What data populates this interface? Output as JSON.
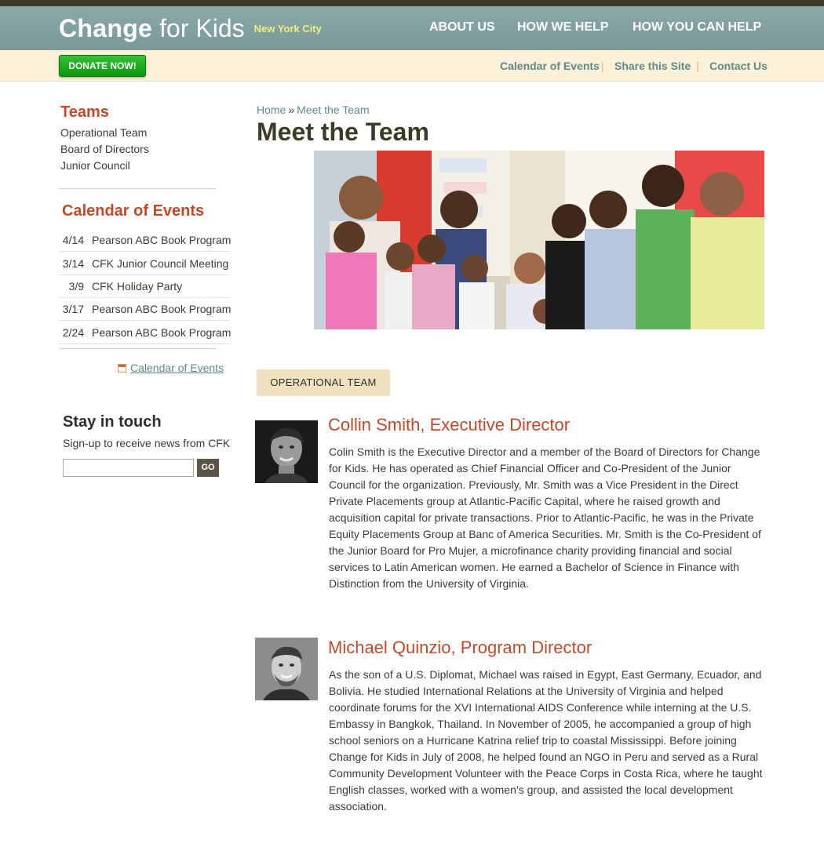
{
  "brand": {
    "name_strong": "Change",
    "name_light": "for Kids",
    "city": "New York City"
  },
  "nav": {
    "items": [
      {
        "label": "ABOUT US"
      },
      {
        "label": "HOW WE HELP"
      },
      {
        "label": "HOW YOU CAN HELP"
      }
    ]
  },
  "subbar": {
    "donate_label": "DONATE NOW!",
    "links": [
      {
        "label": "Calendar of Events"
      },
      {
        "label": "Share this Site"
      },
      {
        "label": "Contact Us"
      }
    ],
    "separator": "|"
  },
  "sidebar": {
    "teams_heading": "Teams",
    "teams": [
      {
        "label": "Operational Team"
      },
      {
        "label": "Board of Directors"
      },
      {
        "label": "Junior Council"
      }
    ],
    "calendar_heading": "Calendar of Events",
    "events": [
      {
        "date": "4/14",
        "name": "Pearson ABC Book Program"
      },
      {
        "date": "3/14",
        "name": "CFK Junior Council Meeting"
      },
      {
        "date": "3/9",
        "name": "CFK Holiday Party"
      },
      {
        "date": "3/17",
        "name": "Pearson ABC Book Program"
      },
      {
        "date": "2/24",
        "name": "Pearson ABC Book Program"
      }
    ],
    "calendar_link": "Calendar of Events",
    "calendar_icon": "calendar-icon",
    "stay_heading": "Stay in touch",
    "stay_sub": "Sign-up to receive news from CFK",
    "newsletter_value": "",
    "go_label": "GO"
  },
  "main": {
    "breadcrumb": {
      "home": "Home",
      "separator": "»",
      "current": "Meet the Team"
    },
    "title": "Meet the Team",
    "tab_label": "OPERATIONAL TEAM",
    "people": [
      {
        "name": "Collin Smith, Executive Director",
        "bio": "Colin Smith is the Executive Director and a member of the Board of Directors for Change for Kids. He has operated as Chief Financial Officer and Co-President of the Junior Council for the organization. Previously, Mr. Smith was a Vice President in the Direct Private Placements group at Atlantic-Pacific Capital, where he raised growth and acquisition capital for private transactions. Prior to Atlantic-Pacific, he was in the Private Equity Placements Group at Banc of America Securities. Mr. Smith is the Co-President of the Junior Board for Pro Mujer, a microfinance charity providing financial and social services to Latin American women. He earned a Bachelor of Science in Finance with Distinction from the University of Virginia."
      },
      {
        "name": "Michael Quinzio, Program Director",
        "bio": "As the son of a U.S. Diplomat, Michael was raised in Egypt, East Germany, Ecuador, and Bolivia. He studied International Relations at the University of Virginia and helped coordinate forums for the XVI International AIDS Conference while interning at the U.S. Embassy in Bangkok, Thailand. In November of 2005, he accompanied a group of high school seniors on a Hurricane Katrina relief trip to coastal Mississippi. Before joining Change for Kids in July of 2008, he helped found an NGO in Peru and served as a Rural Community Development Volunteer with the Peace Corps in Costa Rica, where he taught English classes, worked with a women’s group, and assisted the local development association."
      }
    ]
  },
  "colors": {
    "header": "#7f9e9e",
    "accent": "#c04a2a",
    "link": "#5e8a8a",
    "subbar": "#fbf0d8",
    "donate": "#1aa81c",
    "tab": "#f0e2bf"
  }
}
